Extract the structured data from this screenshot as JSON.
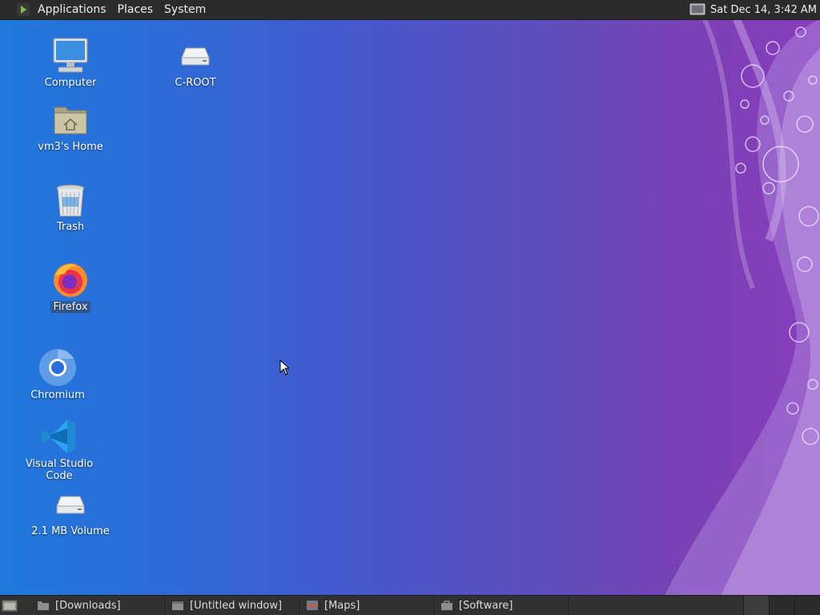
{
  "top_panel": {
    "menus": [
      "Applications",
      "Places",
      "System"
    ],
    "clock": "Sat Dec 14,  3:42 AM"
  },
  "desktop_icons": [
    {
      "label": "Computer",
      "icon": "computer-icon"
    },
    {
      "label": "C-ROOT",
      "icon": "drive-icon"
    },
    {
      "label": "vm3's Home",
      "icon": "home-folder-icon"
    },
    {
      "label": "Trash",
      "icon": "trash-icon"
    },
    {
      "label": "Firefox",
      "icon": "firefox-icon"
    },
    {
      "label": "Chromium",
      "icon": "chromium-icon"
    },
    {
      "label": "Visual Studio Code",
      "icon": "vscode-icon"
    },
    {
      "label": "2.1 MB Volume",
      "icon": "drive-icon"
    }
  ],
  "taskbar": {
    "tasks": [
      {
        "label": "[Downloads]",
        "icon": "folder-icon"
      },
      {
        "label": "[Untitled window]",
        "icon": "window-icon"
      },
      {
        "label": "[Maps]",
        "icon": "maps-icon"
      },
      {
        "label": "[Software]",
        "icon": "software-icon"
      }
    ]
  },
  "colors": {
    "panel": "#2b2b2b",
    "wallpaper_left": "#1f78dc",
    "wallpaper_right": "#8a3dbd"
  }
}
